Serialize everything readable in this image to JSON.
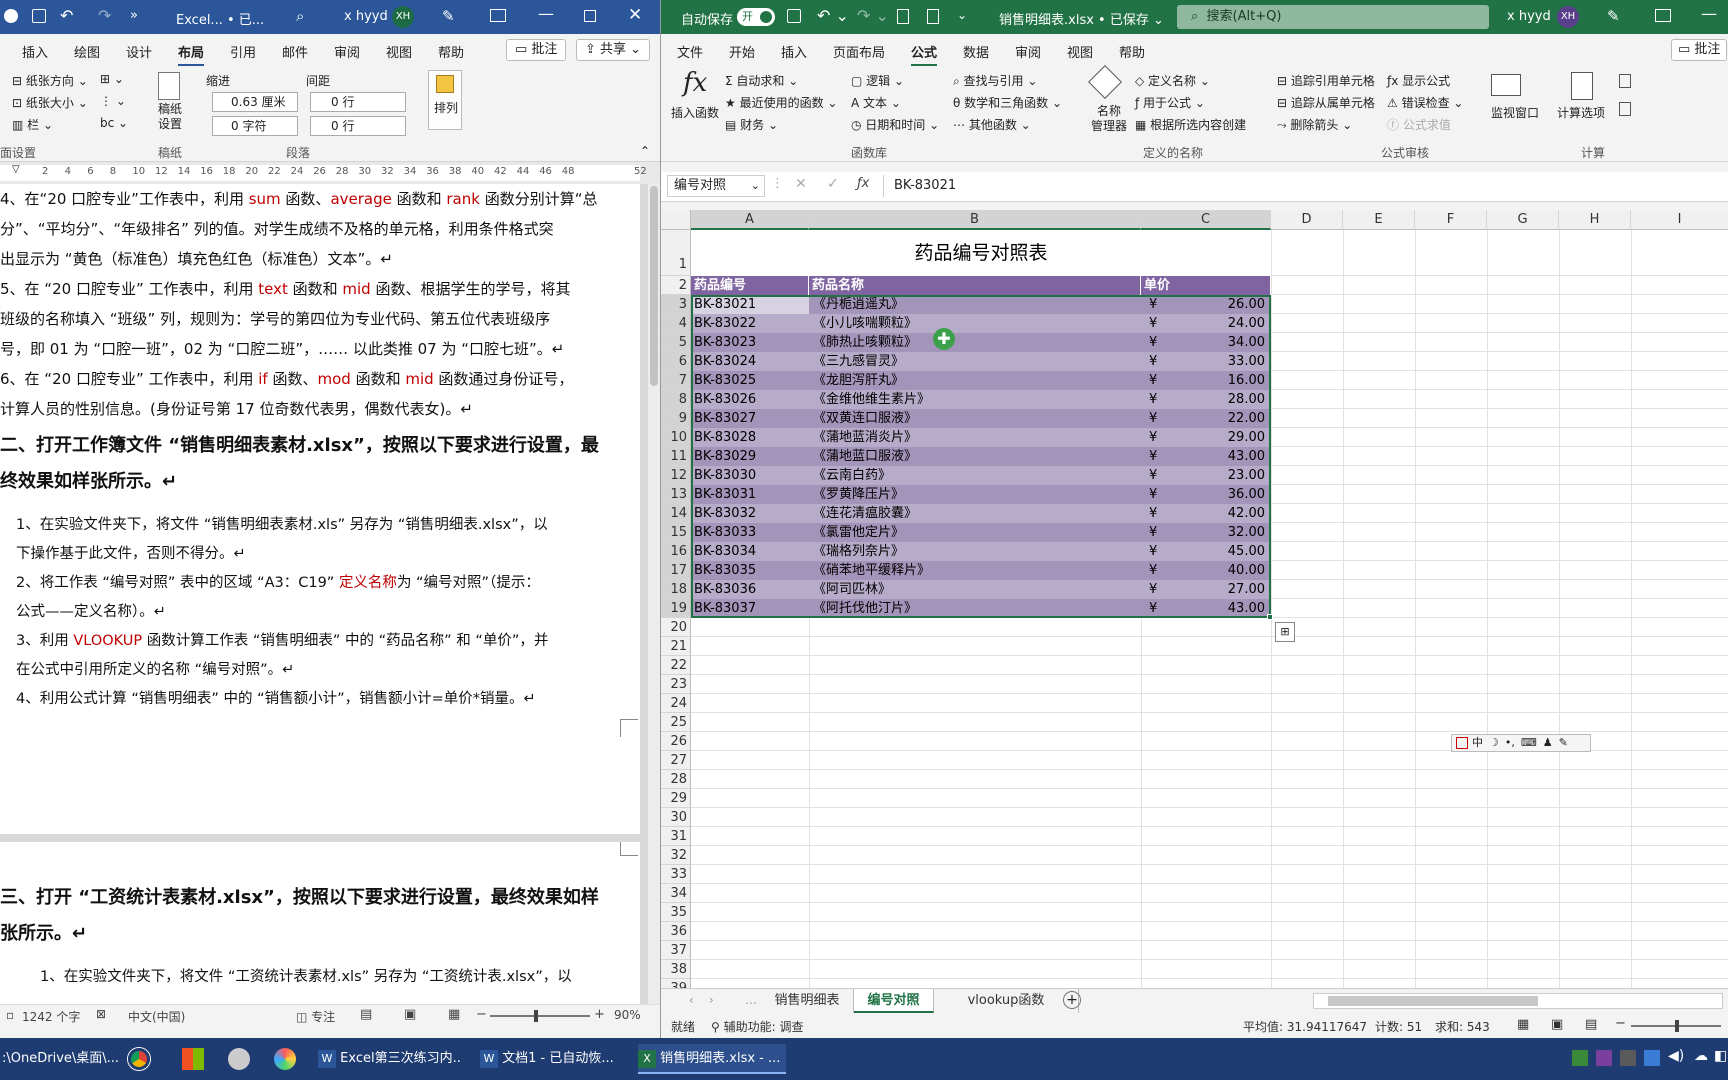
{
  "word": {
    "title": {
      "doc_short": "Excel... • 已...",
      "user": "x hyyd",
      "initials": "XH"
    },
    "tabs": [
      "插入",
      "绘图",
      "设计",
      "布局",
      "引用",
      "邮件",
      "审阅",
      "视图",
      "帮助"
    ],
    "active_tab": "布局",
    "comment_btn": "批注",
    "share_btn": "共享",
    "ribbon": {
      "paper_dir": "纸张方向",
      "paper_size": "纸张大小",
      "columns": "栏",
      "page_setup_group": "面设置",
      "manuscript": "稿纸\n设置",
      "manuscript_group": "稿纸",
      "indent_label": "缩进",
      "spacing_label": "间距",
      "indent_left": "0.63 厘米",
      "indent_right": "0 字符",
      "space_before": "0 行",
      "space_after": "0 行",
      "paragraph_group": "段落",
      "arrange": "排列"
    },
    "ruler_marks": [
      "2",
      "4",
      "6",
      "8",
      "10",
      "12",
      "14",
      "16",
      "18",
      "20",
      "22",
      "24",
      "26",
      "28",
      "30",
      "32",
      "34",
      "36",
      "38",
      "40",
      "42",
      "44",
      "46",
      "48",
      "52"
    ],
    "paragraphs": [
      {
        "segs": [
          [
            "4、在“20 口腔专业”工作表中，利用 ",
            ""
          ],
          [
            "sum",
            ""
          ],
          [
            " 函数、",
            ""
          ],
          [
            "average",
            ""
          ],
          [
            " 函数和 ",
            ""
          ],
          [
            "rank",
            ""
          ],
          [
            " 函数分别计算“总",
            ""
          ]
        ]
      },
      {
        "segs": [
          [
            "分”、“平均分”、“年级排名” 列的值。对学生成绩不及格的单元格，利用条件格式突",
            ""
          ]
        ]
      },
      {
        "segs": [
          [
            "出显示为 “黄色（标准色）填充色红色（标准色）文本”。↵",
            ""
          ]
        ]
      },
      {
        "segs": [
          [
            "5、在 “20 口腔专业” 工作表中，利用 ",
            ""
          ],
          [
            "text",
            ""
          ],
          [
            " 函数和 ",
            ""
          ],
          [
            "mid",
            ""
          ],
          [
            " 函数、根据学生的学号，将其",
            ""
          ]
        ]
      },
      {
        "segs": [
          [
            "班级的名称填入 “班级” 列，规则为：学号的第四位为专业代码、第五位代表班级序",
            ""
          ]
        ]
      },
      {
        "segs": [
          [
            "号，即 01 为 “口腔一班”，02 为 “口腔二班”，…… 以此类推 07 为 “口腔七班”。↵",
            ""
          ]
        ]
      },
      {
        "segs": [
          [
            "6、在 “20 口腔专业” 工作表中，利用 ",
            ""
          ],
          [
            "if",
            ""
          ],
          [
            " 函数、",
            ""
          ],
          [
            "mod",
            ""
          ],
          [
            " 函数和 ",
            ""
          ],
          [
            "mid",
            ""
          ],
          [
            " 函数通过身份证号，",
            ""
          ]
        ]
      },
      {
        "segs": [
          [
            "计算人员的性别信息。(身份证号第 17 位奇数代表男，偶数代表女)。↵",
            ""
          ]
        ]
      }
    ],
    "heading2": [
      "二、打开工作簿文件 “销售明细表素材.xlsx”，按照以下要求进行设置，最",
      "终效果如样张所示。↵"
    ],
    "items2": [
      [
        "1、在实验文件夹下，将文件 “销售明细表素材.xls” 另存为 “销售明细表.xlsx”，以",
        "下操作基于此文件，否则不得分。↵"
      ],
      [
        "2、将工作表 “编号对照” 表中的区域 “A3：C19” ",
        "定义名称",
        "为 “编号对照”（提示：",
        "公式——定义名称）。↵"
      ],
      [
        "3、利用 ",
        "VLOOKUP",
        " 函数计算工作表 “销售明细表” 中的 “药品名称” 和 “单价”，并",
        "在公式中引用所定义的名称 “编号对照”。↵"
      ],
      [
        "4、利用公式计算 “销售明细表” 中的 “销售额小计”，销售额小计=单价*销量。↵"
      ]
    ],
    "heading3": [
      "三、打开 “工资统计表素材.xlsx”，按照以下要求进行设置，最终效果如样",
      "张所示。↵"
    ],
    "partial_line": "1、在实验文件夹下，将文件 “工资统计表素材.xls” 另存为 “工资统计表.xlsx”，以",
    "status": {
      "words": "1242 个字",
      "lang": "中文(中国)",
      "focus": "专注",
      "zoom": "90%"
    }
  },
  "excel": {
    "title": {
      "autosave": "自动保存",
      "toggle": "开",
      "filename": "销售明细表.xlsx • 已保存",
      "search": "搜索(Alt+Q)",
      "user": "x hyyd",
      "initials": "XH"
    },
    "tabs": [
      "文件",
      "开始",
      "插入",
      "页面布局",
      "公式",
      "数据",
      "审阅",
      "视图",
      "帮助"
    ],
    "active_tab": "公式",
    "comment_btn": "批注",
    "ribbon": {
      "insert_fn": "插入函数",
      "autosum": "自动求和",
      "recent": "最近使用的函数",
      "financial": "财务",
      "logical": "逻辑",
      "text": "文本",
      "datetime": "日期和时间",
      "lookup": "查找与引用",
      "math": "数学和三角函数",
      "other": "其他函数",
      "library_group": "函数库",
      "name_mgr": "名称\n管理器",
      "define_name": "定义名称",
      "use_in_formula": "用于公式",
      "create_from_sel": "根据所选内容创建",
      "names_group": "定义的名称",
      "trace_prec": "追踪引用单元格",
      "trace_dep": "追踪从属单元格",
      "remove_arrows": "删除箭头",
      "show_formulas": "显示公式",
      "error_check": "错误检查",
      "eval_formula": "公式求值",
      "watch": "监视窗口",
      "audit_group": "公式审核",
      "calc_options": "计算选项",
      "calc_group": "计算"
    },
    "name_box": "编号对照",
    "formula": "BK-83021",
    "columns": [
      "A",
      "B",
      "C",
      "D",
      "E",
      "F",
      "G",
      "H",
      "I"
    ],
    "sheet_title": "药品编号对照表",
    "headers": [
      "药品编号",
      "药品名称",
      "单价"
    ],
    "currency": "¥",
    "rows": [
      [
        "BK-83021",
        "《丹栀逍遥丸》",
        "26.00"
      ],
      [
        "BK-83022",
        "《小儿咳喘颗粒》",
        "24.00"
      ],
      [
        "BK-83023",
        "《肺热止咳颗粒》",
        "34.00"
      ],
      [
        "BK-83024",
        "《三九感冒灵》",
        "33.00"
      ],
      [
        "BK-83025",
        "《龙胆泻肝丸》",
        "16.00"
      ],
      [
        "BK-83026",
        "《金维他维生素片》",
        "28.00"
      ],
      [
        "BK-83027",
        "《双黄连口服液》",
        "22.00"
      ],
      [
        "BK-83028",
        "《蒲地蓝消炎片》",
        "29.00"
      ],
      [
        "BK-83029",
        "《蒲地蓝口服液》",
        "43.00"
      ],
      [
        "BK-83030",
        "《云南白药》",
        "23.00"
      ],
      [
        "BK-83031",
        "《罗黄降压片》",
        "36.00"
      ],
      [
        "BK-83032",
        "《连花清瘟胶囊》",
        "42.00"
      ],
      [
        "BK-83033",
        "《氯雷他定片》",
        "32.00"
      ],
      [
        "BK-83034",
        "《瑞格列奈片》",
        "45.00"
      ],
      [
        "BK-83035",
        "《硝苯地平缓释片》",
        "40.00"
      ],
      [
        "BK-83036",
        "《阿司匹林》",
        "27.00"
      ],
      [
        "BK-83037",
        "《阿托伐他汀片》",
        "43.00"
      ]
    ],
    "row_numbers": [
      "1",
      "2",
      "3",
      "4",
      "5",
      "6",
      "7",
      "8",
      "9",
      "10",
      "11",
      "12",
      "13",
      "14",
      "15",
      "16",
      "17",
      "18",
      "19",
      "20",
      "21",
      "22",
      "23",
      "24",
      "25",
      "26",
      "27",
      "28",
      "29",
      "30",
      "31",
      "32",
      "33",
      "34",
      "35",
      "36",
      "37",
      "38",
      "39"
    ],
    "ime_toolbar": "中",
    "sheets": [
      "销售明细表",
      "编号对照",
      "vlookup函数"
    ],
    "active_sheet": "编号对照",
    "status": {
      "ready": "就绪",
      "accessibility": "辅助功能: 调查",
      "average": "平均值: 31.94117647",
      "count": "计数: 51",
      "sum": "求和: 543"
    }
  },
  "taskbar": {
    "path": ":\\OneDrive\\桌面\\...",
    "items": [
      "Excel第三次练习内...",
      "文档1 - 已自动恢...",
      "销售明细表.xlsx - ..."
    ]
  },
  "colors": {
    "word_blue": "#2b579a",
    "excel_green": "#217346",
    "header_purple": "#8064a2",
    "row_purple_dark": "#a394ba",
    "row_purple_light": "#b6abc8",
    "red_text": "#c00000"
  }
}
